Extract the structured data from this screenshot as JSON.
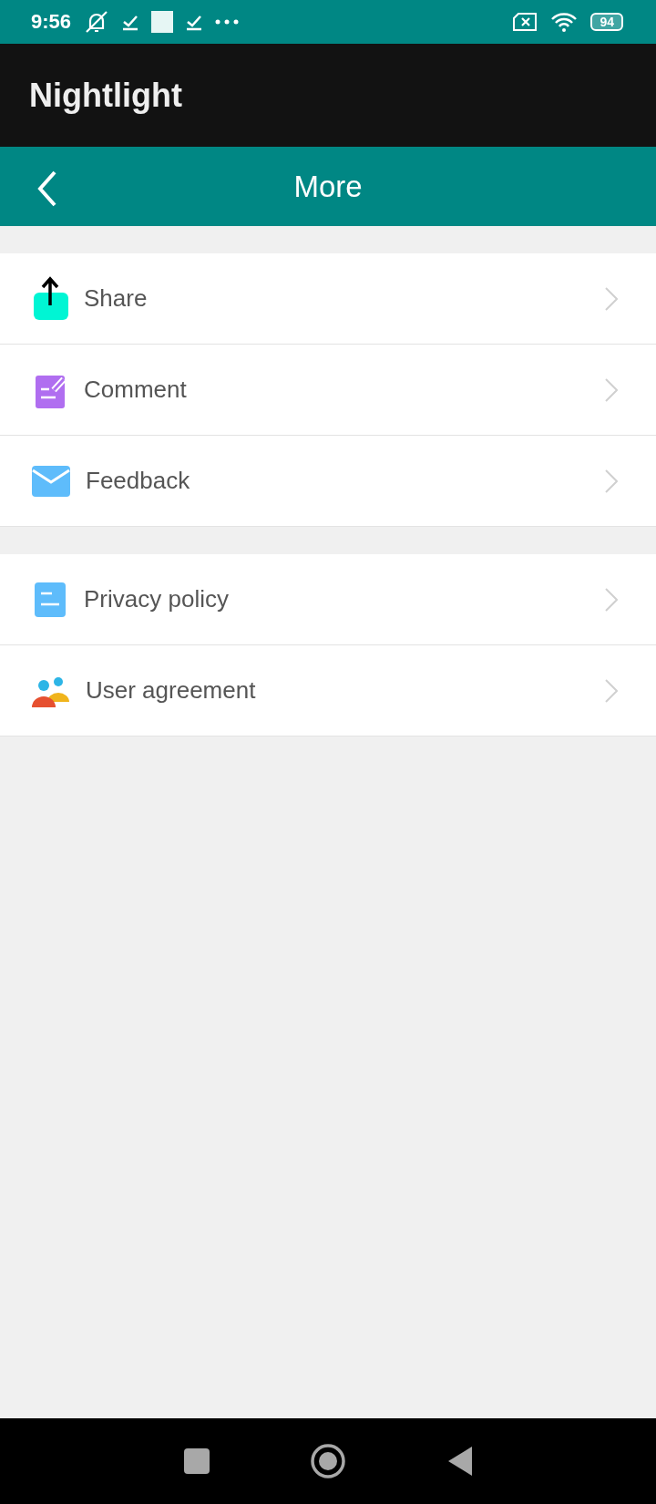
{
  "status_bar": {
    "time": "9:56",
    "battery": "94"
  },
  "app_bar": {
    "title": "Nightlight"
  },
  "header": {
    "title": "More"
  },
  "groups": [
    {
      "items": [
        {
          "kind": "share",
          "label": "Share"
        },
        {
          "kind": "comment",
          "label": "Comment"
        },
        {
          "kind": "feedback",
          "label": "Feedback"
        }
      ]
    },
    {
      "items": [
        {
          "kind": "privacy",
          "label": "Privacy policy"
        },
        {
          "kind": "agreement",
          "label": "User agreement"
        }
      ]
    }
  ]
}
